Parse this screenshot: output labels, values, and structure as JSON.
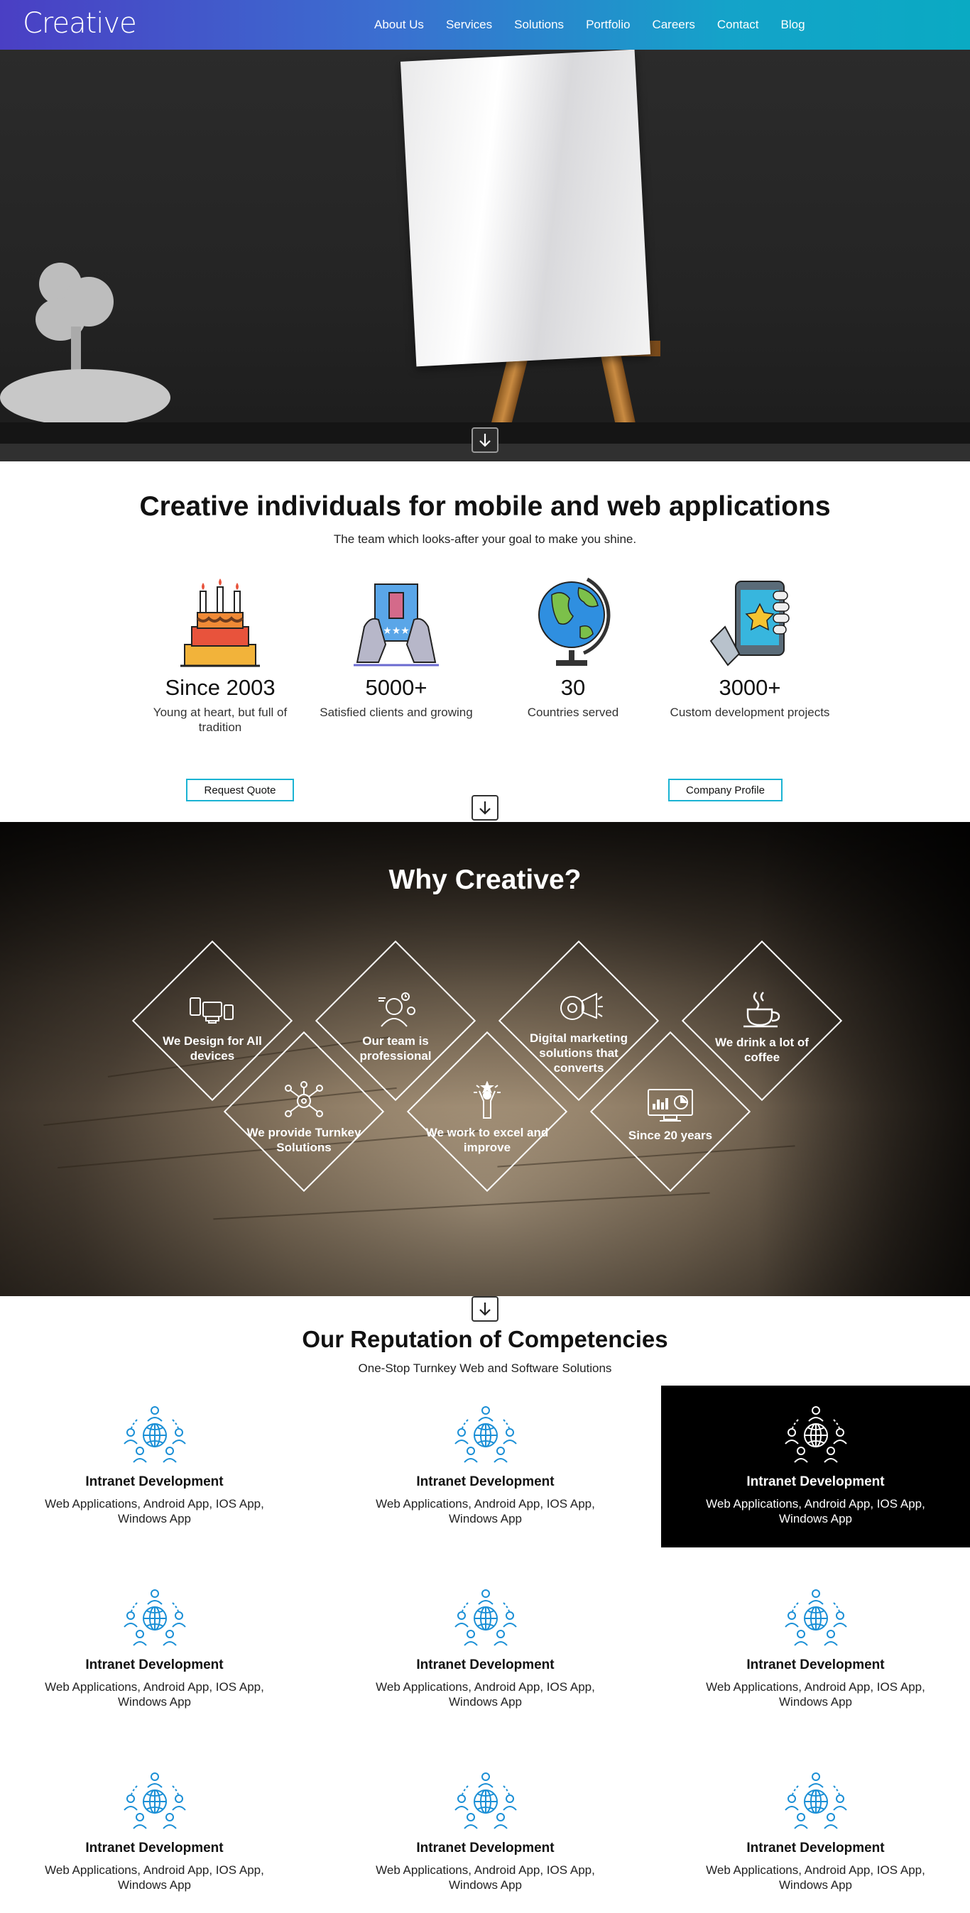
{
  "brand": {
    "logo": "Creative"
  },
  "nav": [
    "About Us",
    "Services",
    "Solutions",
    "Portfolio",
    "Careers",
    "Contact",
    "Blog"
  ],
  "intro": {
    "title": "Creative individuals for mobile and web applications",
    "subtitle": "The team which looks-after your goal to make you shine.",
    "stats": [
      {
        "value": "Since 2003",
        "label": "Young at heart, but full of tradition",
        "icon": "cake-icon"
      },
      {
        "value": "5000+",
        "label": "Satisfied clients and growing",
        "icon": "rating-card-icon"
      },
      {
        "value": "30",
        "label": "Countries served",
        "icon": "globe-icon"
      },
      {
        "value": "3000+",
        "label": "Custom development projects",
        "icon": "phone-star-icon"
      }
    ],
    "buttons": {
      "quote": "Request Quote",
      "profile": "Company Profile"
    }
  },
  "why": {
    "title": "Why Creative?",
    "items": [
      {
        "label": "We Design for All devices",
        "icon": "devices-icon"
      },
      {
        "label": "Our team is professional",
        "icon": "professional-icon"
      },
      {
        "label": "Digital marketing solutions that converts",
        "icon": "megaphone-gear-icon"
      },
      {
        "label": "We drink a lot of coffee",
        "icon": "coffee-icon"
      },
      {
        "label": "We provide Turnkey Solutions",
        "icon": "network-gear-icon"
      },
      {
        "label": "We work to excel and improve",
        "icon": "achiever-icon"
      },
      {
        "label": "Since 20 years",
        "icon": "dashboard-icon"
      }
    ]
  },
  "competencies": {
    "title": "Our Reputation of Competencies",
    "subtitle": "One-Stop Turnkey Web and Software Solutions",
    "cards": [
      {
        "title": "Intranet Development",
        "desc": "Web Applications, Android App, IOS App, Windows App"
      },
      {
        "title": "Intranet Development",
        "desc": "Web Applications, Android App, IOS App, Windows App"
      },
      {
        "title": "Intranet Development",
        "desc": "Web Applications, Android App, IOS App, Windows App"
      },
      {
        "title": "Intranet Development",
        "desc": "Web Applications, Android App, IOS App, Windows App"
      },
      {
        "title": "Intranet Development",
        "desc": "Web Applications, Android App, IOS App, Windows App"
      },
      {
        "title": "Intranet Development",
        "desc": "Web Applications, Android App, IOS App, Windows App"
      },
      {
        "title": "Intranet Development",
        "desc": "Web Applications, Android App, IOS App, Windows App"
      },
      {
        "title": "Intranet Development",
        "desc": "Web Applications, Android App, IOS App, Windows App"
      },
      {
        "title": "Intranet Development",
        "desc": "Web Applications, Android App, IOS App, Windows App"
      }
    ],
    "active_card": 3
  },
  "colors": {
    "accent": "#1ab3d3",
    "header_start": "#4a3fc4",
    "header_end": "#0aaac3",
    "icon_blue": "#1a8fd6"
  }
}
